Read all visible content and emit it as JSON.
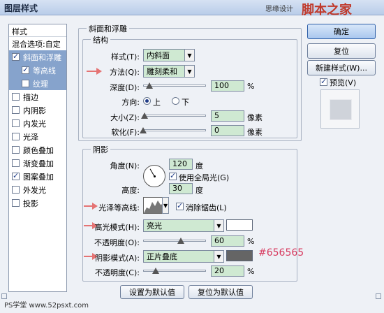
{
  "window": {
    "title": "图层样式",
    "watermark_text": "思缘设计",
    "watermark_logo": "脚本之家",
    "footer_text": "PS学堂 www.52psxt.com"
  },
  "sidebar": {
    "header": "样式",
    "items": [
      {
        "label": "混合选项:自定",
        "checkbox": false,
        "checked": false,
        "selected": false,
        "sub": false
      },
      {
        "label": "斜面和浮雕",
        "checkbox": true,
        "checked": true,
        "selected": true,
        "sub": false
      },
      {
        "label": "等高线",
        "checkbox": true,
        "checked": true,
        "selected": true,
        "sub": true
      },
      {
        "label": "纹理",
        "checkbox": true,
        "checked": false,
        "selected": true,
        "sub": true
      },
      {
        "label": "描边",
        "checkbox": true,
        "checked": false,
        "selected": false,
        "sub": false
      },
      {
        "label": "内阴影",
        "checkbox": true,
        "checked": false,
        "selected": false,
        "sub": false
      },
      {
        "label": "内发光",
        "checkbox": true,
        "checked": false,
        "selected": false,
        "sub": false
      },
      {
        "label": "光泽",
        "checkbox": true,
        "checked": false,
        "selected": false,
        "sub": false
      },
      {
        "label": "颜色叠加",
        "checkbox": true,
        "checked": false,
        "selected": false,
        "sub": false
      },
      {
        "label": "渐变叠加",
        "checkbox": true,
        "checked": false,
        "selected": false,
        "sub": false
      },
      {
        "label": "图案叠加",
        "checkbox": true,
        "checked": true,
        "selected": false,
        "sub": false
      },
      {
        "label": "外发光",
        "checkbox": true,
        "checked": false,
        "selected": false,
        "sub": false
      },
      {
        "label": "投影",
        "checkbox": true,
        "checked": false,
        "selected": false,
        "sub": false
      }
    ]
  },
  "bevel": {
    "title": "斜面和浮雕",
    "structure_title": "结构",
    "style_label": "样式(T):",
    "style_value": "内斜面",
    "technique_label": "方法(Q):",
    "technique_value": "雕刻柔和",
    "depth_label": "深度(D):",
    "depth_value": "100",
    "depth_unit": "%",
    "depth_level": 0.1,
    "direction_label": "方向:",
    "dir_up": "上",
    "dir_down": "下",
    "size_label": "大小(Z):",
    "size_value": "5",
    "size_unit": "像素",
    "size_level": 0.02,
    "soften_label": "软化(F):",
    "soften_value": "0",
    "soften_unit": "像素",
    "soften_level": 0.0
  },
  "shading": {
    "title": "阴影",
    "angle_label": "角度(N):",
    "angle_value": "120",
    "angle_unit": "度",
    "global_light_label": "使用全局光(G)",
    "altitude_label": "高度:",
    "altitude_value": "30",
    "altitude_unit": "度",
    "gloss_label": "光泽等高线:",
    "antialias_label": "消除锯齿(L)",
    "highlight_label": "高光模式(H):",
    "highlight_value": "亮光",
    "highlight_color": "#ffffff",
    "hl_opacity_label": "不透明度(O):",
    "hl_opacity_value": "60",
    "hl_opacity_unit": "%",
    "hl_opacity_level": 0.6,
    "shadow_label": "阴影模式(A):",
    "shadow_value": "正片叠底",
    "shadow_color": "#656565",
    "shadow_color_note": "#656565",
    "sh_opacity_label": "不透明度(C):",
    "sh_opacity_value": "20",
    "sh_opacity_unit": "%",
    "sh_opacity_level": 0.2
  },
  "actions": {
    "set_default": "设置为默认值",
    "reset_default": "复位为默认值",
    "ok": "确定",
    "reset": "复位",
    "new_style": "新建样式(W)...",
    "preview": "预览(V)"
  },
  "annotation_color": "#e57373"
}
